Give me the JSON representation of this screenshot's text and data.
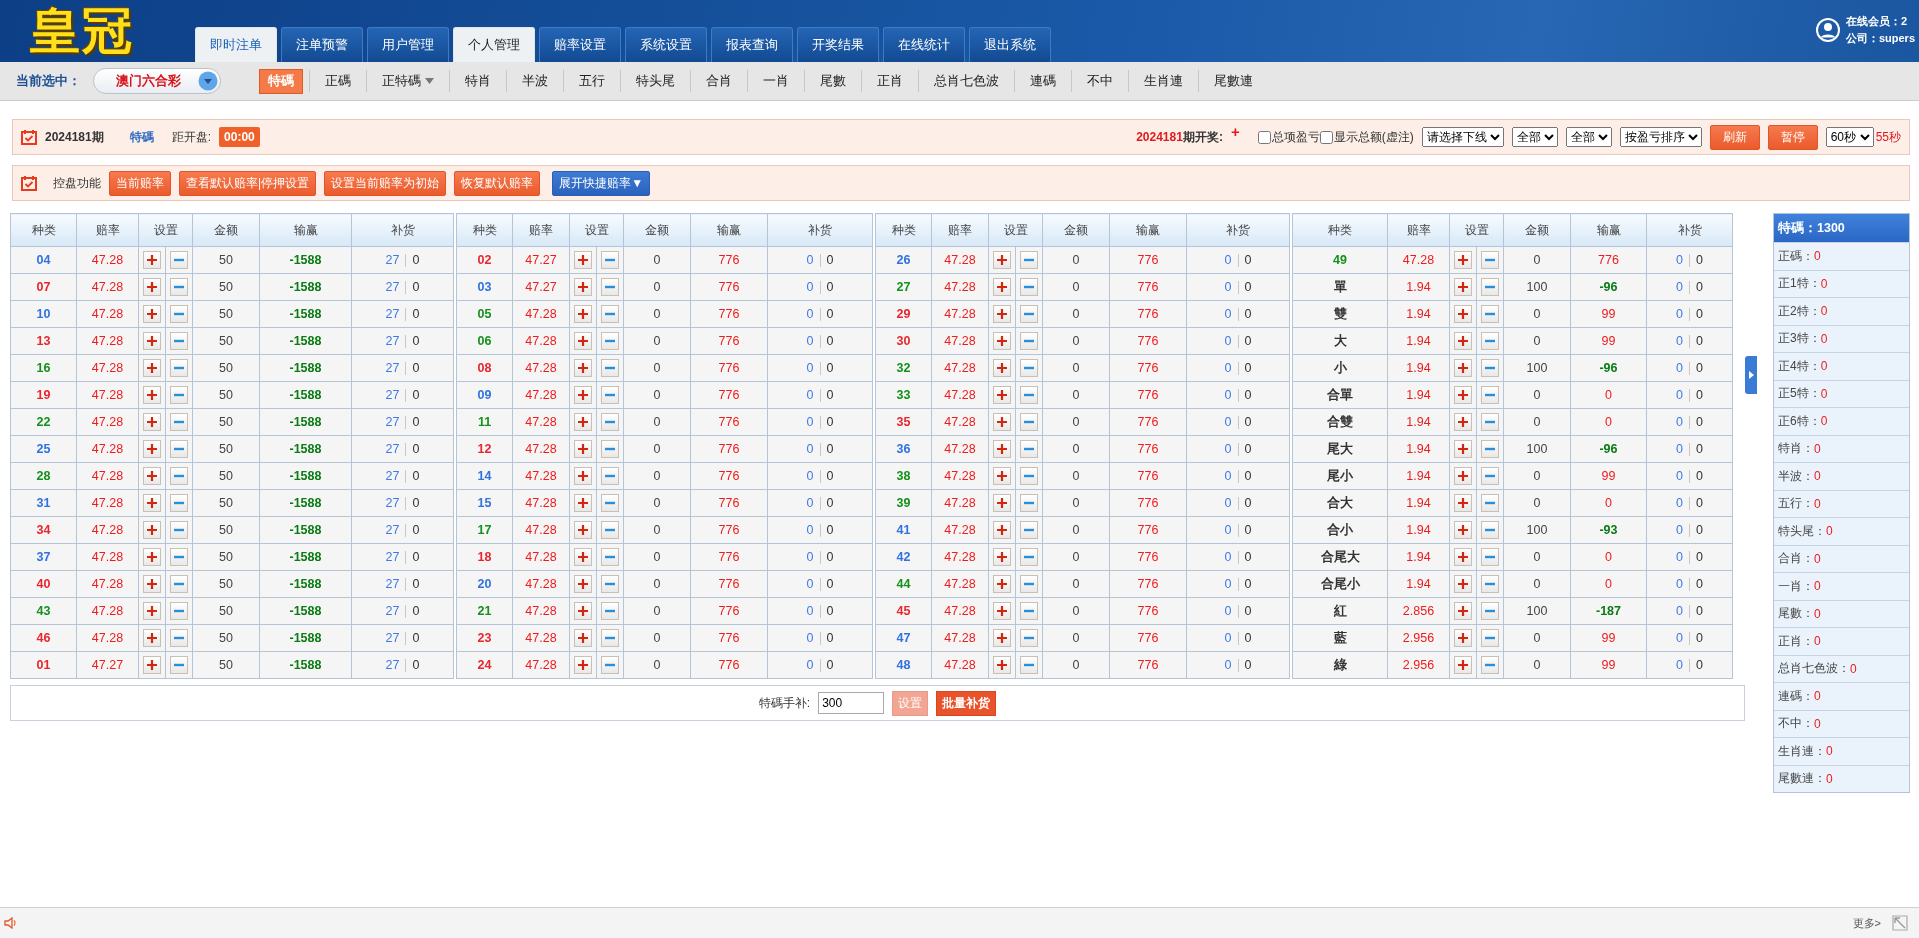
{
  "header": {
    "logo": "皇冠",
    "tabs": [
      {
        "label": "即时注单",
        "selected": true
      },
      {
        "label": "注单预警",
        "selected": false
      },
      {
        "label": "用户管理",
        "selected": false
      },
      {
        "label": "个人管理",
        "selected": true
      },
      {
        "label": "赔率设置",
        "selected": false
      },
      {
        "label": "系统设置",
        "selected": false
      },
      {
        "label": "报表查询",
        "selected": false
      },
      {
        "label": "开奖结果",
        "selected": false
      },
      {
        "label": "在线统计",
        "selected": false
      },
      {
        "label": "退出系统",
        "selected": false
      }
    ],
    "online": "在线会员：2",
    "company": "公司：supers"
  },
  "subnav": {
    "label": "当前选中：",
    "lottery": "澳门六合彩",
    "items": [
      {
        "label": "特碼",
        "selected": true,
        "dropdown": false
      },
      {
        "label": "正碼",
        "selected": false,
        "dropdown": false
      },
      {
        "label": "正特碼",
        "selected": false,
        "dropdown": true
      },
      {
        "label": "特肖",
        "selected": false,
        "dropdown": false
      },
      {
        "label": "半波",
        "selected": false,
        "dropdown": false
      },
      {
        "label": "五行",
        "selected": false,
        "dropdown": false
      },
      {
        "label": "特头尾",
        "selected": false,
        "dropdown": false
      },
      {
        "label": "合肖",
        "selected": false,
        "dropdown": false
      },
      {
        "label": "一肖",
        "selected": false,
        "dropdown": false
      },
      {
        "label": "尾數",
        "selected": false,
        "dropdown": false
      },
      {
        "label": "正肖",
        "selected": false,
        "dropdown": false
      },
      {
        "label": "总肖七色波",
        "selected": false,
        "dropdown": false
      },
      {
        "label": "連碼",
        "selected": false,
        "dropdown": false
      },
      {
        "label": "不中",
        "selected": false,
        "dropdown": false
      },
      {
        "label": "生肖連",
        "selected": false,
        "dropdown": false
      },
      {
        "label": "尾數連",
        "selected": false,
        "dropdown": false
      }
    ]
  },
  "info_bar": {
    "period": "2024181期",
    "type": "特碼",
    "countdown_label": "距开盘:",
    "countdown": "00:00",
    "draw_period": "2024181",
    "draw_label": "期开奖:",
    "draw_mark": "+",
    "checkboxes": [
      {
        "label": "总项盈亏",
        "checked": false
      },
      {
        "label": "显示总额(虚注)",
        "checked": false
      }
    ],
    "selects": [
      "请选择下线",
      "全部",
      "全部",
      "按盈亏排序"
    ],
    "buttons": [
      "刷新",
      "暂停"
    ],
    "interval": "60秒",
    "remaining": "55秒"
  },
  "control_bar": {
    "label": "控盘功能",
    "buttons": [
      {
        "label": "当前赔率",
        "kind": "orange"
      },
      {
        "label": "查看默认赔率|停押设置",
        "kind": "orange"
      },
      {
        "label": "设置当前赔率为初始",
        "kind": "orange"
      },
      {
        "label": "恢复默认赔率",
        "kind": "orange"
      },
      {
        "label": "展开快捷赔率▼",
        "kind": "blue"
      }
    ]
  },
  "tables": [
    {
      "columns": [
        "种类",
        "赔率",
        "设置",
        "金额",
        "输赢",
        "补货"
      ],
      "rows": [
        {
          "label": "04",
          "color": "#2f72e0",
          "odds": "47.28",
          "amount": "50",
          "win_loss": "-1588",
          "negative": true,
          "refill": [
            "27",
            "0"
          ]
        },
        {
          "label": "07",
          "color": "#e8262d",
          "odds": "47.28",
          "amount": "50",
          "win_loss": "-1588",
          "negative": true,
          "refill": [
            "27",
            "0"
          ]
        },
        {
          "label": "10",
          "color": "#2f72e0",
          "odds": "47.28",
          "amount": "50",
          "win_loss": "-1588",
          "negative": true,
          "refill": [
            "27",
            "0"
          ]
        },
        {
          "label": "13",
          "color": "#e8262d",
          "odds": "47.28",
          "amount": "50",
          "win_loss": "-1588",
          "negative": true,
          "refill": [
            "27",
            "0"
          ]
        },
        {
          "label": "16",
          "color": "#13911a",
          "odds": "47.28",
          "amount": "50",
          "win_loss": "-1588",
          "negative": true,
          "refill": [
            "27",
            "0"
          ]
        },
        {
          "label": "19",
          "color": "#e8262d",
          "odds": "47.28",
          "amount": "50",
          "win_loss": "-1588",
          "negative": true,
          "refill": [
            "27",
            "0"
          ]
        },
        {
          "label": "22",
          "color": "#13911a",
          "odds": "47.28",
          "amount": "50",
          "win_loss": "-1588",
          "negative": true,
          "refill": [
            "27",
            "0"
          ]
        },
        {
          "label": "25",
          "color": "#2f72e0",
          "odds": "47.28",
          "amount": "50",
          "win_loss": "-1588",
          "negative": true,
          "refill": [
            "27",
            "0"
          ]
        },
        {
          "label": "28",
          "color": "#13911a",
          "odds": "47.28",
          "amount": "50",
          "win_loss": "-1588",
          "negative": true,
          "refill": [
            "27",
            "0"
          ]
        },
        {
          "label": "31",
          "color": "#2f72e0",
          "odds": "47.28",
          "amount": "50",
          "win_loss": "-1588",
          "negative": true,
          "refill": [
            "27",
            "0"
          ]
        },
        {
          "label": "34",
          "color": "#e8262d",
          "odds": "47.28",
          "amount": "50",
          "win_loss": "-1588",
          "negative": true,
          "refill": [
            "27",
            "0"
          ]
        },
        {
          "label": "37",
          "color": "#2f72e0",
          "odds": "47.28",
          "amount": "50",
          "win_loss": "-1588",
          "negative": true,
          "refill": [
            "27",
            "0"
          ]
        },
        {
          "label": "40",
          "color": "#e8262d",
          "odds": "47.28",
          "amount": "50",
          "win_loss": "-1588",
          "negative": true,
          "refill": [
            "27",
            "0"
          ]
        },
        {
          "label": "43",
          "color": "#13911a",
          "odds": "47.28",
          "amount": "50",
          "win_loss": "-1588",
          "negative": true,
          "refill": [
            "27",
            "0"
          ]
        },
        {
          "label": "46",
          "color": "#e8262d",
          "odds": "47.28",
          "amount": "50",
          "win_loss": "-1588",
          "negative": true,
          "refill": [
            "27",
            "0"
          ]
        },
        {
          "label": "01",
          "color": "#e8262d",
          "odds": "47.27",
          "amount": "50",
          "win_loss": "-1588",
          "negative": true,
          "refill": [
            "27",
            "0"
          ]
        }
      ]
    },
    {
      "columns": [
        "种类",
        "赔率",
        "设置",
        "金额",
        "输赢",
        "补货"
      ],
      "rows": [
        {
          "label": "02",
          "color": "#e8262d",
          "odds": "47.27",
          "amount": "0",
          "win_loss": "776",
          "negative": false,
          "refill": [
            "0",
            "0"
          ]
        },
        {
          "label": "03",
          "color": "#2f72e0",
          "odds": "47.27",
          "amount": "0",
          "win_loss": "776",
          "negative": false,
          "refill": [
            "0",
            "0"
          ]
        },
        {
          "label": "05",
          "color": "#13911a",
          "odds": "47.28",
          "amount": "0",
          "win_loss": "776",
          "negative": false,
          "refill": [
            "0",
            "0"
          ]
        },
        {
          "label": "06",
          "color": "#13911a",
          "odds": "47.28",
          "amount": "0",
          "win_loss": "776",
          "negative": false,
          "refill": [
            "0",
            "0"
          ]
        },
        {
          "label": "08",
          "color": "#e8262d",
          "odds": "47.28",
          "amount": "0",
          "win_loss": "776",
          "negative": false,
          "refill": [
            "0",
            "0"
          ]
        },
        {
          "label": "09",
          "color": "#2f72e0",
          "odds": "47.28",
          "amount": "0",
          "win_loss": "776",
          "negative": false,
          "refill": [
            "0",
            "0"
          ]
        },
        {
          "label": "11",
          "color": "#13911a",
          "odds": "47.28",
          "amount": "0",
          "win_loss": "776",
          "negative": false,
          "refill": [
            "0",
            "0"
          ]
        },
        {
          "label": "12",
          "color": "#e8262d",
          "odds": "47.28",
          "amount": "0",
          "win_loss": "776",
          "negative": false,
          "refill": [
            "0",
            "0"
          ]
        },
        {
          "label": "14",
          "color": "#2f72e0",
          "odds": "47.28",
          "amount": "0",
          "win_loss": "776",
          "negative": false,
          "refill": [
            "0",
            "0"
          ]
        },
        {
          "label": "15",
          "color": "#2f72e0",
          "odds": "47.28",
          "amount": "0",
          "win_loss": "776",
          "negative": false,
          "refill": [
            "0",
            "0"
          ]
        },
        {
          "label": "17",
          "color": "#13911a",
          "odds": "47.28",
          "amount": "0",
          "win_loss": "776",
          "negative": false,
          "refill": [
            "0",
            "0"
          ]
        },
        {
          "label": "18",
          "color": "#e8262d",
          "odds": "47.28",
          "amount": "0",
          "win_loss": "776",
          "negative": false,
          "refill": [
            "0",
            "0"
          ]
        },
        {
          "label": "20",
          "color": "#2f72e0",
          "odds": "47.28",
          "amount": "0",
          "win_loss": "776",
          "negative": false,
          "refill": [
            "0",
            "0"
          ]
        },
        {
          "label": "21",
          "color": "#13911a",
          "odds": "47.28",
          "amount": "0",
          "win_loss": "776",
          "negative": false,
          "refill": [
            "0",
            "0"
          ]
        },
        {
          "label": "23",
          "color": "#e8262d",
          "odds": "47.28",
          "amount": "0",
          "win_loss": "776",
          "negative": false,
          "refill": [
            "0",
            "0"
          ]
        },
        {
          "label": "24",
          "color": "#e8262d",
          "odds": "47.28",
          "amount": "0",
          "win_loss": "776",
          "negative": false,
          "refill": [
            "0",
            "0"
          ]
        }
      ]
    },
    {
      "columns": [
        "种类",
        "赔率",
        "设置",
        "金额",
        "输赢",
        "补货"
      ],
      "rows": [
        {
          "label": "26",
          "color": "#2f72e0",
          "odds": "47.28",
          "amount": "0",
          "win_loss": "776",
          "negative": false,
          "refill": [
            "0",
            "0"
          ]
        },
        {
          "label": "27",
          "color": "#13911a",
          "odds": "47.28",
          "amount": "0",
          "win_loss": "776",
          "negative": false,
          "refill": [
            "0",
            "0"
          ]
        },
        {
          "label": "29",
          "color": "#e8262d",
          "odds": "47.28",
          "amount": "0",
          "win_loss": "776",
          "negative": false,
          "refill": [
            "0",
            "0"
          ]
        },
        {
          "label": "30",
          "color": "#e8262d",
          "odds": "47.28",
          "amount": "0",
          "win_loss": "776",
          "negative": false,
          "refill": [
            "0",
            "0"
          ]
        },
        {
          "label": "32",
          "color": "#13911a",
          "odds": "47.28",
          "amount": "0",
          "win_loss": "776",
          "negative": false,
          "refill": [
            "0",
            "0"
          ]
        },
        {
          "label": "33",
          "color": "#13911a",
          "odds": "47.28",
          "amount": "0",
          "win_loss": "776",
          "negative": false,
          "refill": [
            "0",
            "0"
          ]
        },
        {
          "label": "35",
          "color": "#e8262d",
          "odds": "47.28",
          "amount": "0",
          "win_loss": "776",
          "negative": false,
          "refill": [
            "0",
            "0"
          ]
        },
        {
          "label": "36",
          "color": "#2f72e0",
          "odds": "47.28",
          "amount": "0",
          "win_loss": "776",
          "negative": false,
          "refill": [
            "0",
            "0"
          ]
        },
        {
          "label": "38",
          "color": "#13911a",
          "odds": "47.28",
          "amount": "0",
          "win_loss": "776",
          "negative": false,
          "refill": [
            "0",
            "0"
          ]
        },
        {
          "label": "39",
          "color": "#13911a",
          "odds": "47.28",
          "amount": "0",
          "win_loss": "776",
          "negative": false,
          "refill": [
            "0",
            "0"
          ]
        },
        {
          "label": "41",
          "color": "#2f72e0",
          "odds": "47.28",
          "amount": "0",
          "win_loss": "776",
          "negative": false,
          "refill": [
            "0",
            "0"
          ]
        },
        {
          "label": "42",
          "color": "#2f72e0",
          "odds": "47.28",
          "amount": "0",
          "win_loss": "776",
          "negative": false,
          "refill": [
            "0",
            "0"
          ]
        },
        {
          "label": "44",
          "color": "#13911a",
          "odds": "47.28",
          "amount": "0",
          "win_loss": "776",
          "negative": false,
          "refill": [
            "0",
            "0"
          ]
        },
        {
          "label": "45",
          "color": "#e8262d",
          "odds": "47.28",
          "amount": "0",
          "win_loss": "776",
          "negative": false,
          "refill": [
            "0",
            "0"
          ]
        },
        {
          "label": "47",
          "color": "#2f72e0",
          "odds": "47.28",
          "amount": "0",
          "win_loss": "776",
          "negative": false,
          "refill": [
            "0",
            "0"
          ]
        },
        {
          "label": "48",
          "color": "#2f72e0",
          "odds": "47.28",
          "amount": "0",
          "win_loss": "776",
          "negative": false,
          "refill": [
            "0",
            "0"
          ]
        }
      ]
    },
    {
      "columns": [
        "种类",
        "赔率",
        "设置",
        "金额",
        "输赢",
        "补货"
      ],
      "rows": [
        {
          "label": "49",
          "color": "#13911a",
          "odds": "47.28",
          "amount": "0",
          "win_loss": "776",
          "negative": false,
          "refill": [
            "0",
            "0"
          ]
        },
        {
          "label": "單",
          "color": "#333333",
          "odds": "1.94",
          "amount": "100",
          "win_loss": "-96",
          "negative": true,
          "refill": [
            "0",
            "0"
          ]
        },
        {
          "label": "雙",
          "color": "#333333",
          "odds": "1.94",
          "amount": "0",
          "win_loss": "99",
          "negative": false,
          "refill": [
            "0",
            "0"
          ]
        },
        {
          "label": "大",
          "color": "#333333",
          "odds": "1.94",
          "amount": "0",
          "win_loss": "99",
          "negative": false,
          "refill": [
            "0",
            "0"
          ]
        },
        {
          "label": "小",
          "color": "#333333",
          "odds": "1.94",
          "amount": "100",
          "win_loss": "-96",
          "negative": true,
          "refill": [
            "0",
            "0"
          ]
        },
        {
          "label": "合單",
          "color": "#333333",
          "odds": "1.94",
          "amount": "0",
          "win_loss": "0",
          "negative": false,
          "refill": [
            "0",
            "0"
          ]
        },
        {
          "label": "合雙",
          "color": "#333333",
          "odds": "1.94",
          "amount": "0",
          "win_loss": "0",
          "negative": false,
          "refill": [
            "0",
            "0"
          ]
        },
        {
          "label": "尾大",
          "color": "#333333",
          "odds": "1.94",
          "amount": "100",
          "win_loss": "-96",
          "negative": true,
          "refill": [
            "0",
            "0"
          ]
        },
        {
          "label": "尾小",
          "color": "#333333",
          "odds": "1.94",
          "amount": "0",
          "win_loss": "99",
          "negative": false,
          "refill": [
            "0",
            "0"
          ]
        },
        {
          "label": "合大",
          "color": "#333333",
          "odds": "1.94",
          "amount": "0",
          "win_loss": "0",
          "negative": false,
          "refill": [
            "0",
            "0"
          ]
        },
        {
          "label": "合小",
          "color": "#333333",
          "odds": "1.94",
          "amount": "100",
          "win_loss": "-93",
          "negative": true,
          "refill": [
            "0",
            "0"
          ]
        },
        {
          "label": "合尾大",
          "color": "#333333",
          "odds": "1.94",
          "amount": "0",
          "win_loss": "0",
          "negative": false,
          "refill": [
            "0",
            "0"
          ]
        },
        {
          "label": "合尾小",
          "color": "#333333",
          "odds": "1.94",
          "amount": "0",
          "win_loss": "0",
          "negative": false,
          "refill": [
            "0",
            "0"
          ]
        },
        {
          "label": "紅",
          "color": "#333333",
          "odds": "2.856",
          "amount": "100",
          "win_loss": "-187",
          "negative": true,
          "refill": [
            "0",
            "0"
          ]
        },
        {
          "label": "藍",
          "color": "#333333",
          "odds": "2.956",
          "amount": "0",
          "win_loss": "99",
          "negative": false,
          "refill": [
            "0",
            "0"
          ]
        },
        {
          "label": "綠",
          "color": "#333333",
          "odds": "2.956",
          "amount": "0",
          "win_loss": "99",
          "negative": false,
          "refill": [
            "0",
            "0"
          ]
        }
      ]
    }
  ],
  "quick_fill": {
    "label": "特碼手补:",
    "value": "300",
    "buttons": [
      {
        "label": "设置",
        "disabled": true
      },
      {
        "label": "批量补货",
        "disabled": false
      }
    ]
  },
  "summary": {
    "title": "特碼：1300",
    "items": [
      {
        "label": "正碼：",
        "value": "0"
      },
      {
        "label": "正1特：",
        "value": "0"
      },
      {
        "label": "正2特：",
        "value": "0"
      },
      {
        "label": "正3特：",
        "value": "0"
      },
      {
        "label": "正4特：",
        "value": "0"
      },
      {
        "label": "正5特：",
        "value": "0"
      },
      {
        "label": "正6特：",
        "value": "0"
      },
      {
        "label": "特肖：",
        "value": "0"
      },
      {
        "label": "半波：",
        "value": "0"
      },
      {
        "label": "五行：",
        "value": "0"
      },
      {
        "label": "特头尾：",
        "value": "0"
      },
      {
        "label": "合肖：",
        "value": "0"
      },
      {
        "label": "一肖：",
        "value": "0"
      },
      {
        "label": "尾數：",
        "value": "0"
      },
      {
        "label": "正肖：",
        "value": "0"
      },
      {
        "label": "总肖七色波：",
        "value": "0"
      },
      {
        "label": "連碼：",
        "value": "0"
      },
      {
        "label": "不中：",
        "value": "0"
      },
      {
        "label": "生肖連：",
        "value": "0"
      },
      {
        "label": "尾數連：",
        "value": "0"
      }
    ]
  },
  "footer": {
    "more": "更多>"
  }
}
